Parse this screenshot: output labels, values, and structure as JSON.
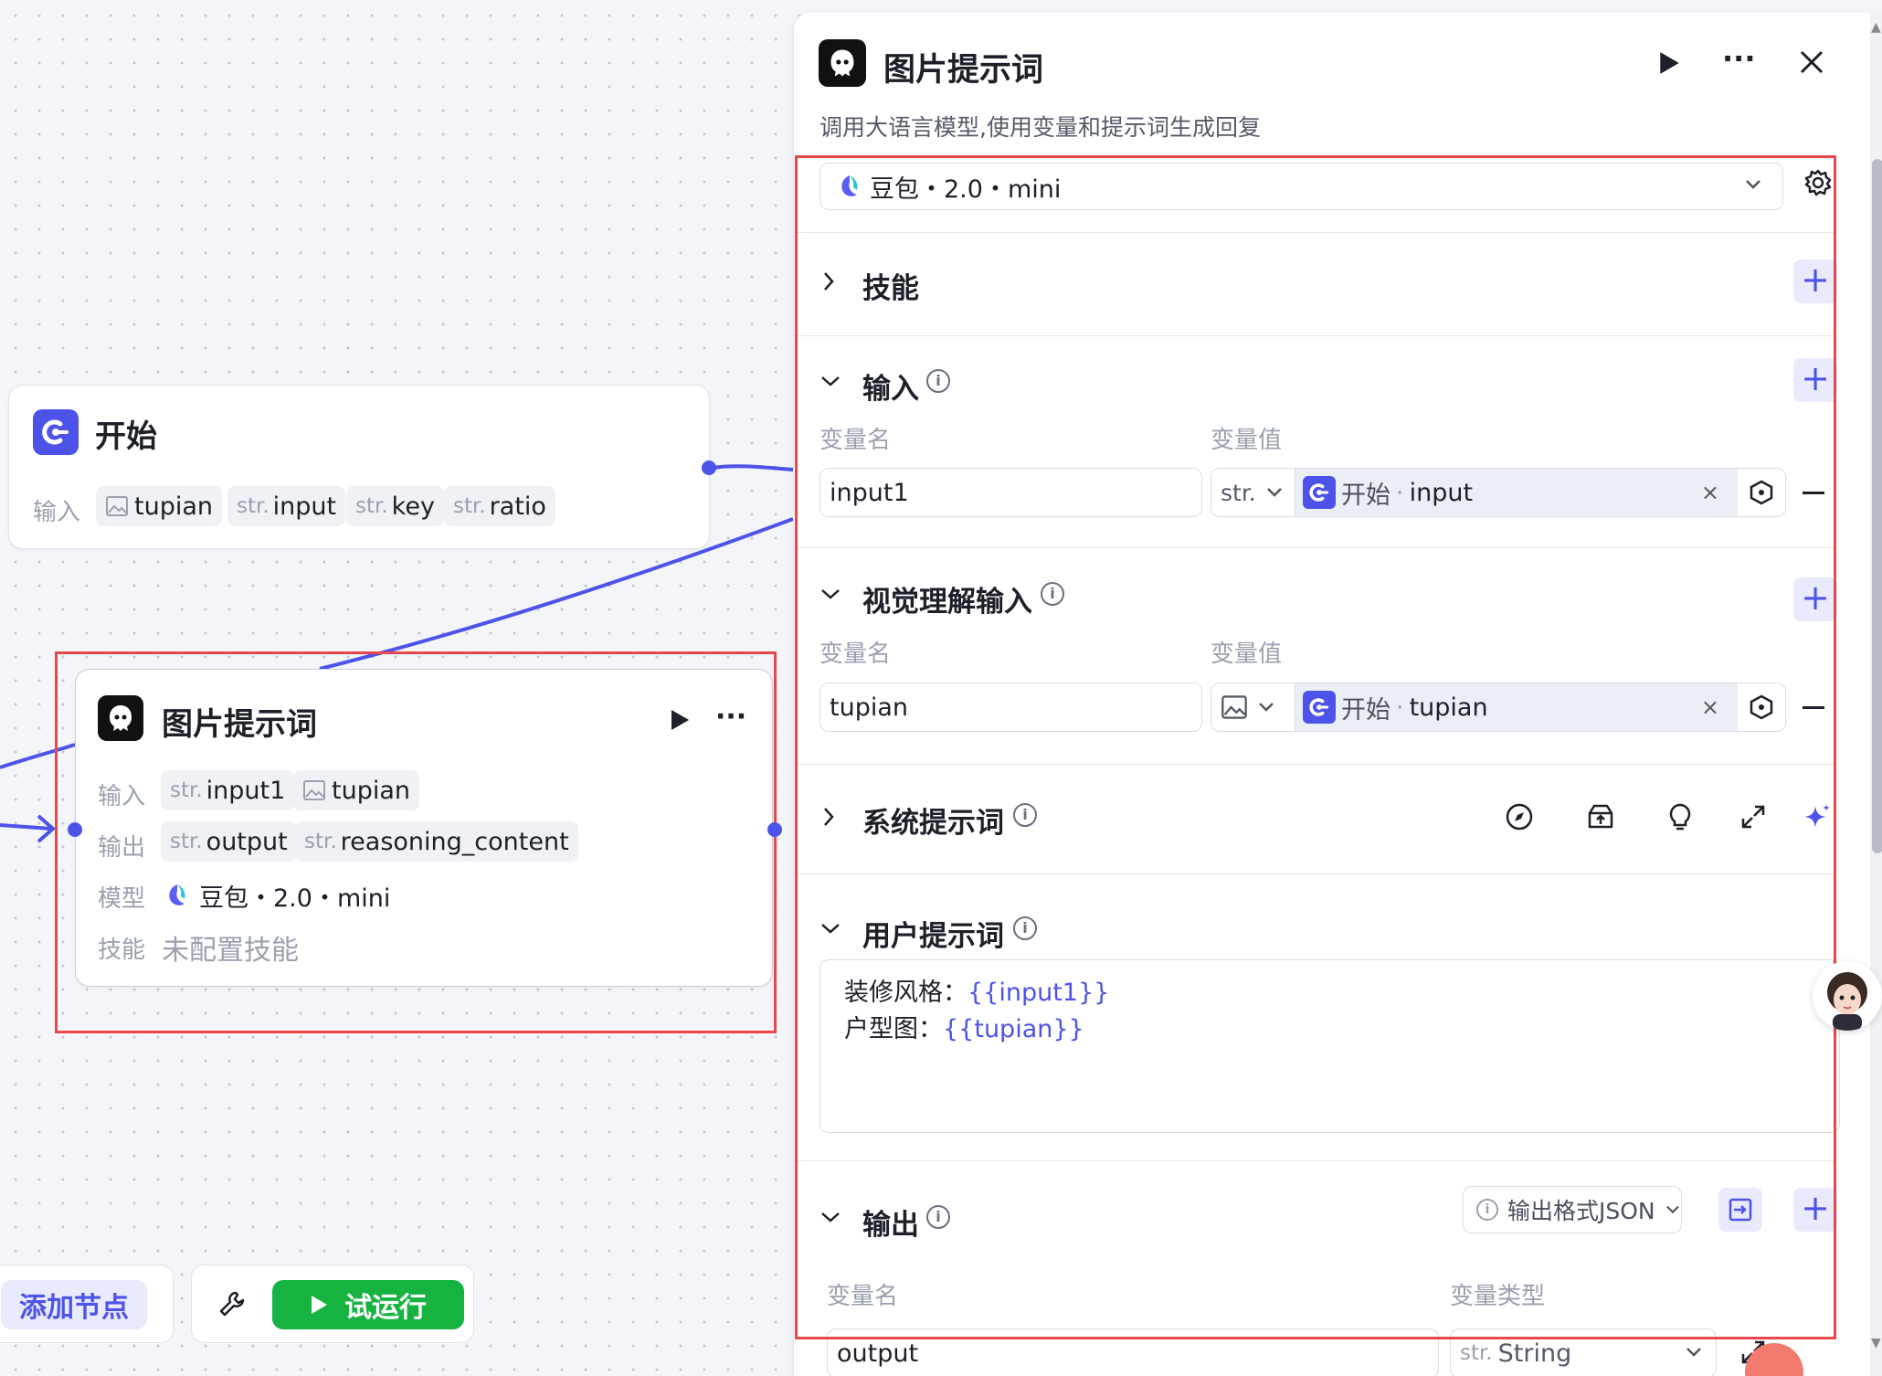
{
  "canvas": {
    "start_node": {
      "title": "开始",
      "input_label": "输入",
      "inputs": [
        {
          "type_icon": "image-icon",
          "name": "tupian"
        },
        {
          "type": "str.",
          "name": "input"
        },
        {
          "type": "str.",
          "name": "key"
        },
        {
          "type": "str.",
          "name": "ratio"
        }
      ]
    },
    "prompt_node": {
      "title": "图片提示词",
      "input_label": "输入",
      "inputs": [
        {
          "type": "str.",
          "name": "input1"
        },
        {
          "type_icon": "image-icon",
          "name": "tupian"
        }
      ],
      "output_label": "输出",
      "outputs": [
        {
          "type": "str.",
          "name": "output"
        },
        {
          "type": "str.",
          "name": "reasoning_content"
        }
      ],
      "model_label": "模型",
      "model": "豆包・2.0・mini",
      "skill_label": "技能",
      "skill_value": "未配置技能"
    },
    "add_node_label": "添加节点",
    "run_label": "试运行"
  },
  "panel": {
    "title": "图片提示词",
    "description": "调用大语言模型,使用变量和提示词生成回复",
    "model": "豆包・2.0・mini",
    "skills_label": "技能",
    "input_section": {
      "title": "输入",
      "col_name": "变量名",
      "col_value": "变量值",
      "name": "input1",
      "type": "str.",
      "ref_node": "开始",
      "ref_var": "input"
    },
    "vision_section": {
      "title": "视觉理解输入",
      "col_name": "变量名",
      "col_value": "变量值",
      "name": "tupian",
      "ref_node": "开始",
      "ref_var": "tupian"
    },
    "system_prompt_label": "系统提示词",
    "user_prompt": {
      "title": "用户提示词",
      "line1_text": "装修风格：",
      "line1_var": "{{input1}}",
      "line2_text": "户型图：",
      "line2_var": "{{tupian}}"
    },
    "output_section": {
      "title": "输出",
      "format_label": "输出格式JSON",
      "col_name": "变量名",
      "col_type": "变量类型",
      "name": "output",
      "type_prefix": "str.",
      "type": "String"
    }
  },
  "colors": {
    "accent": "#4d53e8",
    "run_green": "#16b340",
    "highlight": "#e8484d"
  }
}
